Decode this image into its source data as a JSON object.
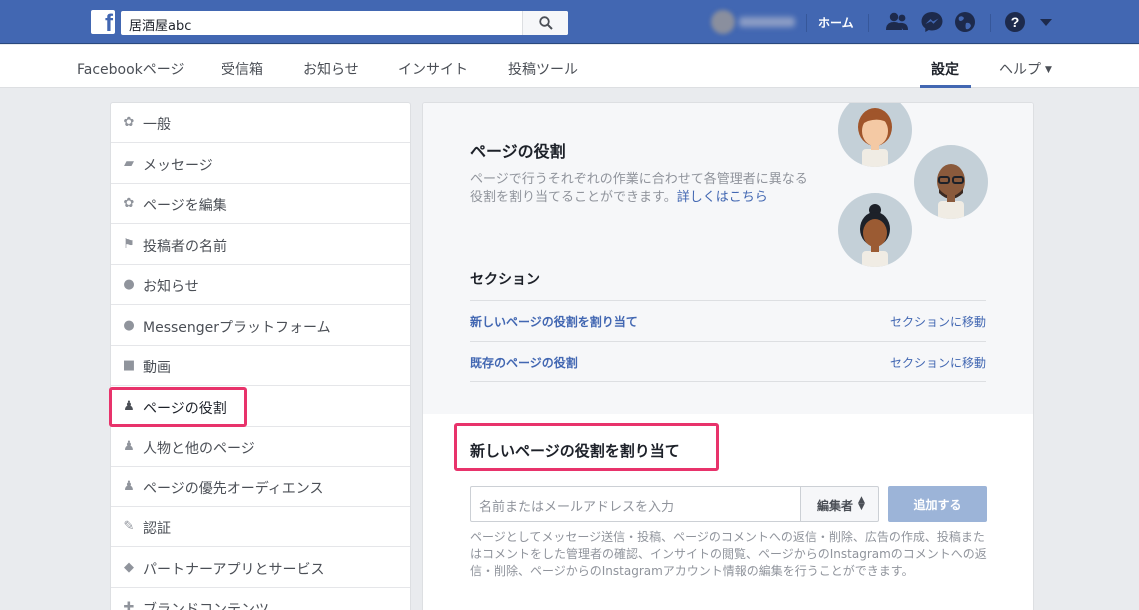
{
  "topbar": {
    "search_value": "居酒屋abc",
    "home_label": "ホーム",
    "help_label": "?"
  },
  "pagenav": {
    "items": [
      {
        "label": "Facebookページ"
      },
      {
        "label": "受信箱"
      },
      {
        "label": "お知らせ"
      },
      {
        "label": "インサイト"
      },
      {
        "label": "投稿ツール"
      }
    ],
    "settings_label": "設定",
    "help_label": "ヘルプ",
    "help_caret": "▼"
  },
  "sidebar": {
    "items": [
      {
        "label": "一般",
        "icon": "gear-icon"
      },
      {
        "label": "メッセージ",
        "icon": "chat-icon"
      },
      {
        "label": "ページを編集",
        "icon": "gear-icon"
      },
      {
        "label": "投稿者の名前",
        "icon": "flag-icon"
      },
      {
        "label": "お知らせ",
        "icon": "globe-icon"
      },
      {
        "label": "Messengerプラットフォーム",
        "icon": "messenger-icon"
      },
      {
        "label": "動画",
        "icon": "video-icon"
      },
      {
        "label": "ページの役割",
        "icon": "person-icon",
        "active": true
      },
      {
        "label": "人物と他のページ",
        "icon": "people-icon"
      },
      {
        "label": "ページの優先オーディエンス",
        "icon": "people-icon"
      },
      {
        "label": "認証",
        "icon": "wrench-icon"
      },
      {
        "label": "パートナーアプリとサービス",
        "icon": "cube-icon"
      },
      {
        "label": "ブランドコンテンツ",
        "icon": "handshake-icon"
      }
    ]
  },
  "main": {
    "title": "ページの役割",
    "description": "ページで行うそれぞれの作業に合わせて各管理者に異なる役割を割り当てることができます。",
    "learn_more": "詳しくはこちら",
    "section_title": "セクション",
    "sections": [
      {
        "label": "新しいページの役割を割り当て",
        "goto": "セクションに移動"
      },
      {
        "label": "既存のページの役割",
        "goto": "セクションに移動"
      }
    ],
    "assign": {
      "title": "新しいページの役割を割り当て",
      "placeholder": "名前またはメールアドレスを入力",
      "role_value": "編集者",
      "add_button": "追加する",
      "description": "ページとしてメッセージ送信・投稿、ページのコメントへの返信・削除、広告の作成、投稿またはコメントをした管理者の確認、インサイトの閲覧、ページからのInstagramのコメントへの返信・削除、ページからのInstagramアカウント情報の編集を行うことができます。"
    }
  },
  "colors": {
    "brand_blue": "#4267b2",
    "highlight": "#e8336b",
    "add_button": "#9cb4d8"
  }
}
